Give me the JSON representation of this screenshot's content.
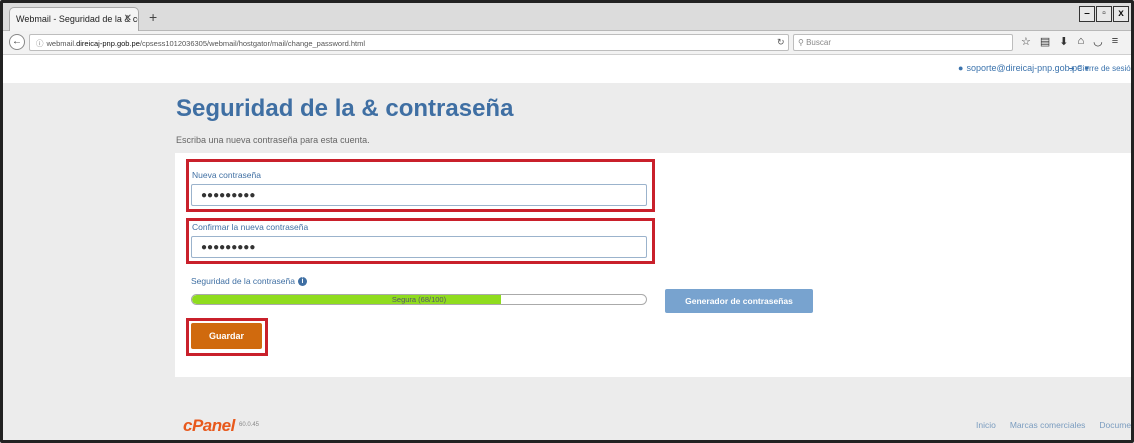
{
  "browser": {
    "tab_title": "Webmail - Seguridad de la & co",
    "tab_close": "✕",
    "new_tab": "+",
    "window_controls": [
      "–",
      "▫",
      "x"
    ],
    "url_prefix": "webmail.",
    "url_domain": "direicaj-pnp.gob.pe",
    "url_path": "/cpsess1012036305/webmail/hostgator/mail/change_password.html",
    "search_placeholder": "Buscar",
    "toolbar_icons": [
      "star-icon",
      "bookmarks-icon",
      "download-icon",
      "home-icon",
      "pocket-icon",
      "menu-icon"
    ]
  },
  "topnav": {
    "user": "soporte@direicaj-pnp.gob.pe",
    "user_caret": "▾",
    "logout": "Cierre de sesión"
  },
  "page": {
    "title": "Seguridad de la & contraseña",
    "subtitle": "Escriba una nueva contraseña para esta cuenta."
  },
  "form": {
    "new_password_label": "Nueva contraseña",
    "new_password_value": "●●●●●●●●●",
    "confirm_password_label": "Confirmar la nueva contraseña",
    "confirm_password_value": "●●●●●●●●●",
    "strength_label": "Seguridad de la contraseña",
    "strength_text": "Segura (68/100)",
    "strength_score": 68,
    "strength_max": 100,
    "generator_button": "Generador de contraseñas",
    "save_button": "Guardar"
  },
  "footer": {
    "logo": "cPanel",
    "version": "60.0.45",
    "links": [
      "Inicio",
      "Marcas comerciales",
      "Docume"
    ]
  },
  "colors": {
    "accent": "#3f6fa3",
    "highlight": "#c9202b",
    "save": "#d06a0e",
    "meter": "#8fdc1e"
  }
}
